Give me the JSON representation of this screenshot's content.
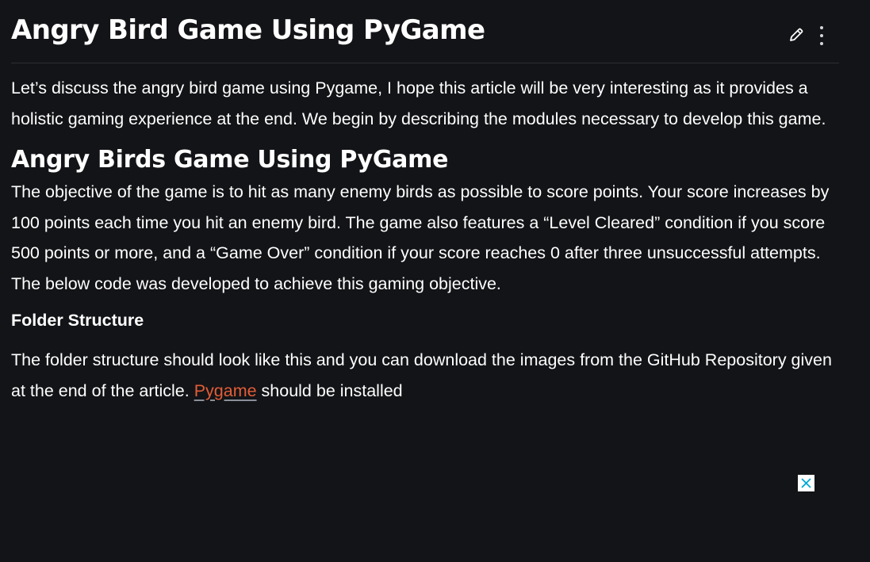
{
  "article": {
    "title": "Angry Bird Game Using PyGame",
    "intro": "Let’s discuss the angry bird game using Pygame, I hope this article will be very interesting as it provides a holistic gaming experience at the end. We begin by describing the modules necessary to develop this game.",
    "section_heading": "Angry Birds Game Using PyGame",
    "section_text": "The objective of the game is to hit as many enemy birds as possible to score points. Your score increases by 100 points each time you hit an enemy bird. The game also features a “Level Cleared” condition if you score 500 points or more, and a “Game Over” condition if your score reaches 0 after three unsuccessful attempts. The below code was developed to achieve this gaming objective.",
    "subheading": "Folder Structure",
    "folder_text_before": "The folder structure should look like this and you can download the images from the GitHub Repository given at the end of the article. ",
    "folder_link": "Pygame",
    "folder_text_after": " should be installed"
  },
  "toolbar": {
    "edit_icon": "pencil-icon",
    "more_icon": "more-vertical-icon"
  },
  "ad": {
    "close_icon": "close-icon"
  },
  "colors": {
    "background": "#131417",
    "text": "#ffffff",
    "link": "#e25d38",
    "ad_close": "#00a9d4"
  }
}
